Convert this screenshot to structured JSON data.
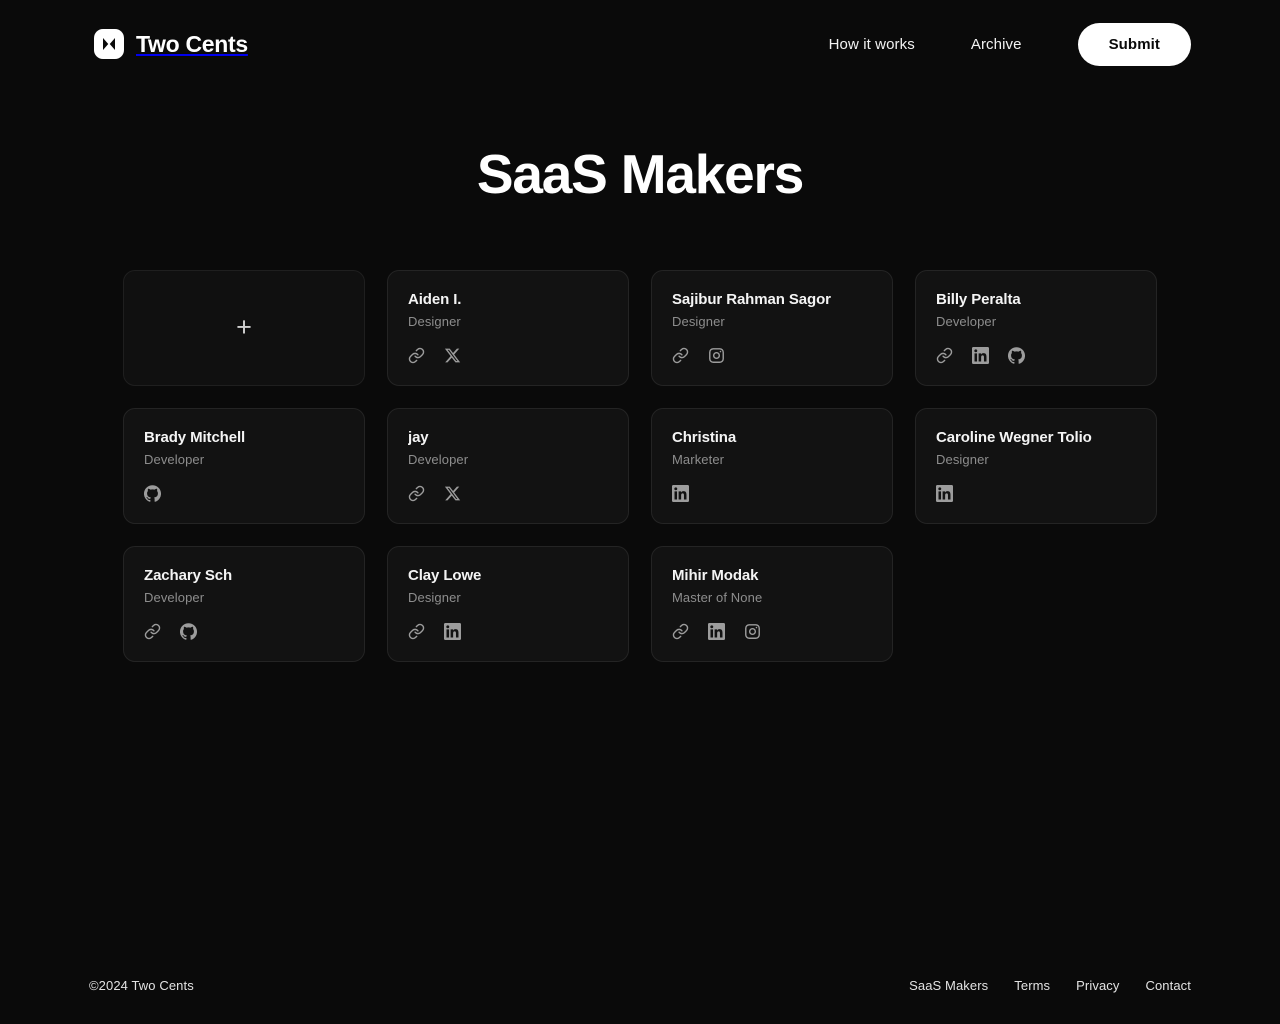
{
  "header": {
    "logo_icon": "two-cents-bowtie-logo",
    "brand": "Two Cents",
    "nav": [
      {
        "label": "How it works"
      },
      {
        "label": "Archive"
      }
    ],
    "cta": "Submit"
  },
  "main": {
    "title": "SaaS Makers",
    "add_card": {
      "icon": "plus-icon",
      "label": "+"
    },
    "cards": [
      {
        "name": "Aiden I.",
        "role": "Designer",
        "socials": [
          "link-icon",
          "x-twitter-icon"
        ]
      },
      {
        "name": "Sajibur Rahman Sagor",
        "role": "Designer",
        "socials": [
          "link-icon",
          "instagram-icon"
        ]
      },
      {
        "name": "Billy Peralta",
        "role": "Developer",
        "socials": [
          "link-icon",
          "linkedin-icon",
          "github-icon"
        ]
      },
      {
        "name": "Brady Mitchell",
        "role": "Developer",
        "socials": [
          "github-icon"
        ]
      },
      {
        "name": "jay",
        "role": "Developer",
        "socials": [
          "link-icon",
          "x-twitter-icon"
        ]
      },
      {
        "name": "Christina",
        "role": "Marketer",
        "socials": [
          "linkedin-icon"
        ]
      },
      {
        "name": "Caroline Wegner Tolio",
        "role": "Designer",
        "socials": [
          "linkedin-icon"
        ]
      },
      {
        "name": "Zachary Sch",
        "role": "Developer",
        "socials": [
          "link-icon",
          "github-icon"
        ]
      },
      {
        "name": "Clay Lowe",
        "role": "Designer",
        "socials": [
          "link-icon",
          "linkedin-icon"
        ]
      },
      {
        "name": "Mihir Modak",
        "role": "Master of None",
        "socials": [
          "link-icon",
          "linkedin-icon",
          "instagram-icon"
        ]
      }
    ]
  },
  "footer": {
    "copyright": "©2024 Two Cents",
    "links": [
      {
        "label": "SaaS Makers"
      },
      {
        "label": "Terms"
      },
      {
        "label": "Privacy"
      },
      {
        "label": "Contact"
      }
    ]
  },
  "colors": {
    "page_background": "#0a0a0a",
    "card_background": "#121212",
    "card_border": "#242424",
    "text_primary": "#ffffff",
    "text_muted": "#8d8d8d",
    "accent": "#ffffff"
  }
}
